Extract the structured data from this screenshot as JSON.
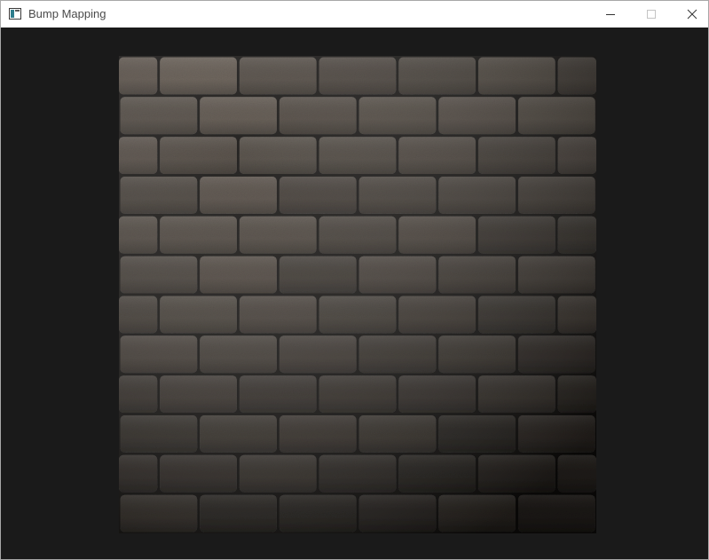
{
  "window": {
    "title": "Bump Mapping",
    "icon": "window-app-icon"
  },
  "controls": {
    "minimize": "minimize-icon",
    "maximize": "maximize-icon",
    "close": "close-icon"
  },
  "scene": {
    "texture": "brick-wall",
    "clear_color": "#1a1a1a",
    "brick_color": "#4a423a",
    "mortar_color": "#0f0d0b"
  }
}
